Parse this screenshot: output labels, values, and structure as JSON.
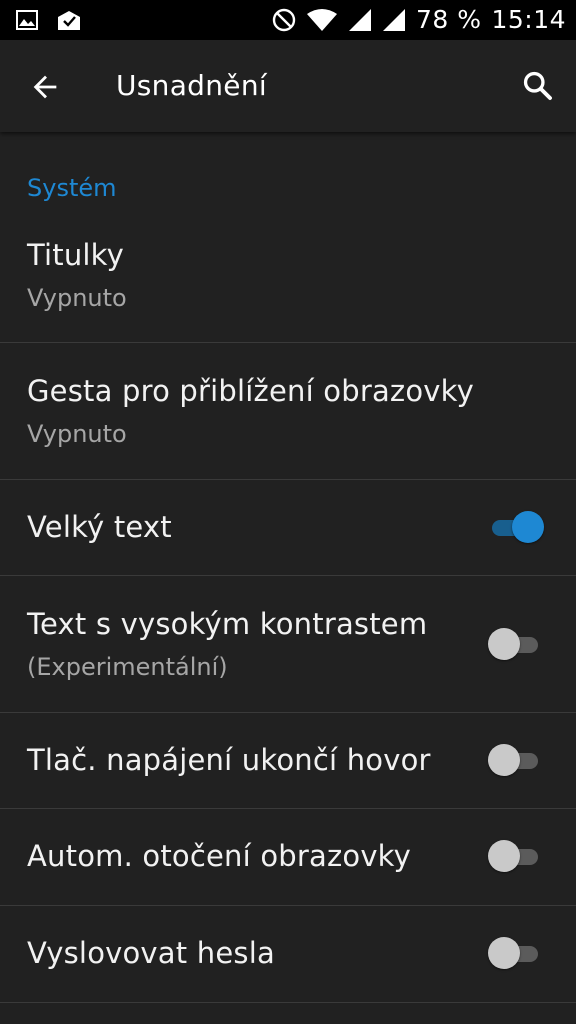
{
  "status_bar": {
    "battery": "78 %",
    "time": "15:14",
    "icons": [
      "image-icon",
      "mail-check-icon",
      "do-not-disturb-icon",
      "wifi-icon",
      "signal-icon",
      "signal-icon-2"
    ]
  },
  "app_bar": {
    "title": "Usnadnění",
    "back_icon": "arrow-back-icon",
    "search_icon": "search-icon"
  },
  "section": {
    "title": "Systém"
  },
  "items": [
    {
      "title": "Titulky",
      "summary": "Vypnuto"
    },
    {
      "title": "Gesta pro přiblížení obrazovky",
      "summary": "Vypnuto"
    },
    {
      "title": "Velký text",
      "checked": true
    },
    {
      "title": "Text s vysokým kontrastem",
      "summary": "(Experimentální)",
      "checked": false
    },
    {
      "title": "Tlač. napájení ukončí hovor",
      "checked": false
    },
    {
      "title": "Autom. otočení obrazovky",
      "checked": false
    },
    {
      "title": "Vyslovovat hesla",
      "checked": false
    }
  ],
  "colors": {
    "background": "#212121",
    "accent": "#1e88d3",
    "status_bar": "#000000"
  }
}
